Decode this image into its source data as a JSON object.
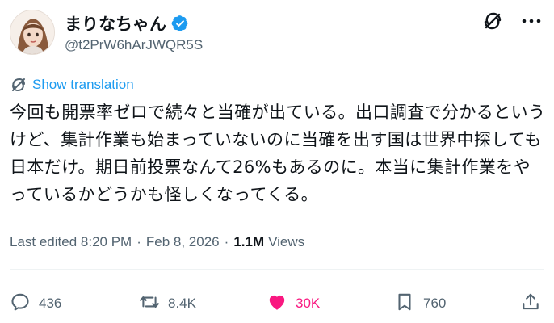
{
  "author": {
    "display_name": "まりなちゃん",
    "handle": "@t2PrW6hArJWQR5S",
    "verified": true
  },
  "header_icons": [
    "grok-icon",
    "more-icon"
  ],
  "translate": {
    "label": "Show translation",
    "icon": "translate-icon"
  },
  "post": {
    "text": "今回も開票率ゼロで続々と当確が出ている。出口調査で分かるというけど、集計作業も始まっていないのに当確を出す国は世界中探しても日本だけ。期日前投票なんて26%もあるのに。本当に集計作業をやっているかどうかも怪しくなってくる。"
  },
  "meta": {
    "edited": "Last edited 8:20 PM",
    "separator": "·",
    "date": "Feb 8, 2026",
    "views_count": "1.1M",
    "views_label": "Views"
  },
  "actions": {
    "replies": "436",
    "reposts": "8.4K",
    "likes": "30K",
    "bookmarks": "760"
  },
  "colors": {
    "accent": "#1d9bf0",
    "like": "#f91880",
    "muted": "#536471",
    "text": "#0f1419"
  }
}
